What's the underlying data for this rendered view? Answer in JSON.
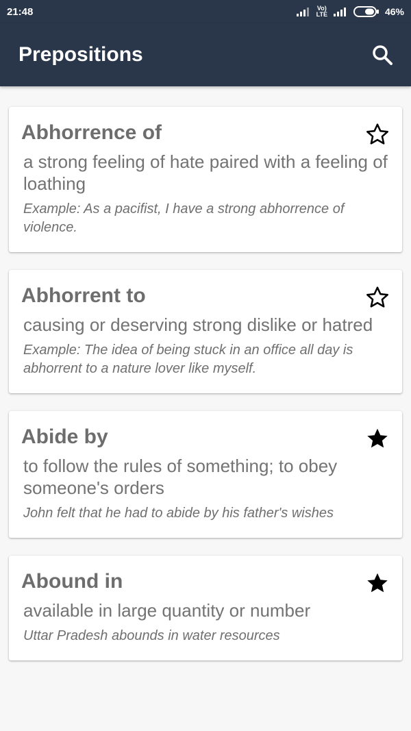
{
  "status_bar": {
    "time": "21:48",
    "volte_top": "Vo)",
    "volte_bottom": "LTE",
    "battery": "46%"
  },
  "toolbar": {
    "title": "Prepositions",
    "search_icon": "search-icon"
  },
  "cards": [
    {
      "term": "Abhorrence of",
      "meaning": "a strong feeling of hate paired with a feeling of loathing",
      "example": "Example: As a pacifist, I have a strong abhorrence of violence.",
      "starred": false
    },
    {
      "term": "Abhorrent to",
      "meaning": "causing or deserving strong dislike or hatred",
      "example": "Example: The idea of being stuck in an office all day is abhorrent to a nature lover like myself.",
      "starred": false
    },
    {
      "term": "Abide by",
      "meaning": "to follow the rules of something; to obey someone's orders",
      "example": "John felt that he had to abide by his father's wishes",
      "starred": true
    },
    {
      "term": "Abound in",
      "meaning": "available in large quantity or number",
      "example": "Uttar Pradesh abounds in water resources",
      "starred": true
    }
  ],
  "colors": {
    "toolbar_bg": "#2a3649",
    "page_bg": "#f7f7f7",
    "card_bg": "#ffffff",
    "term_text": "#6d6d6d",
    "body_text": "#737373"
  }
}
